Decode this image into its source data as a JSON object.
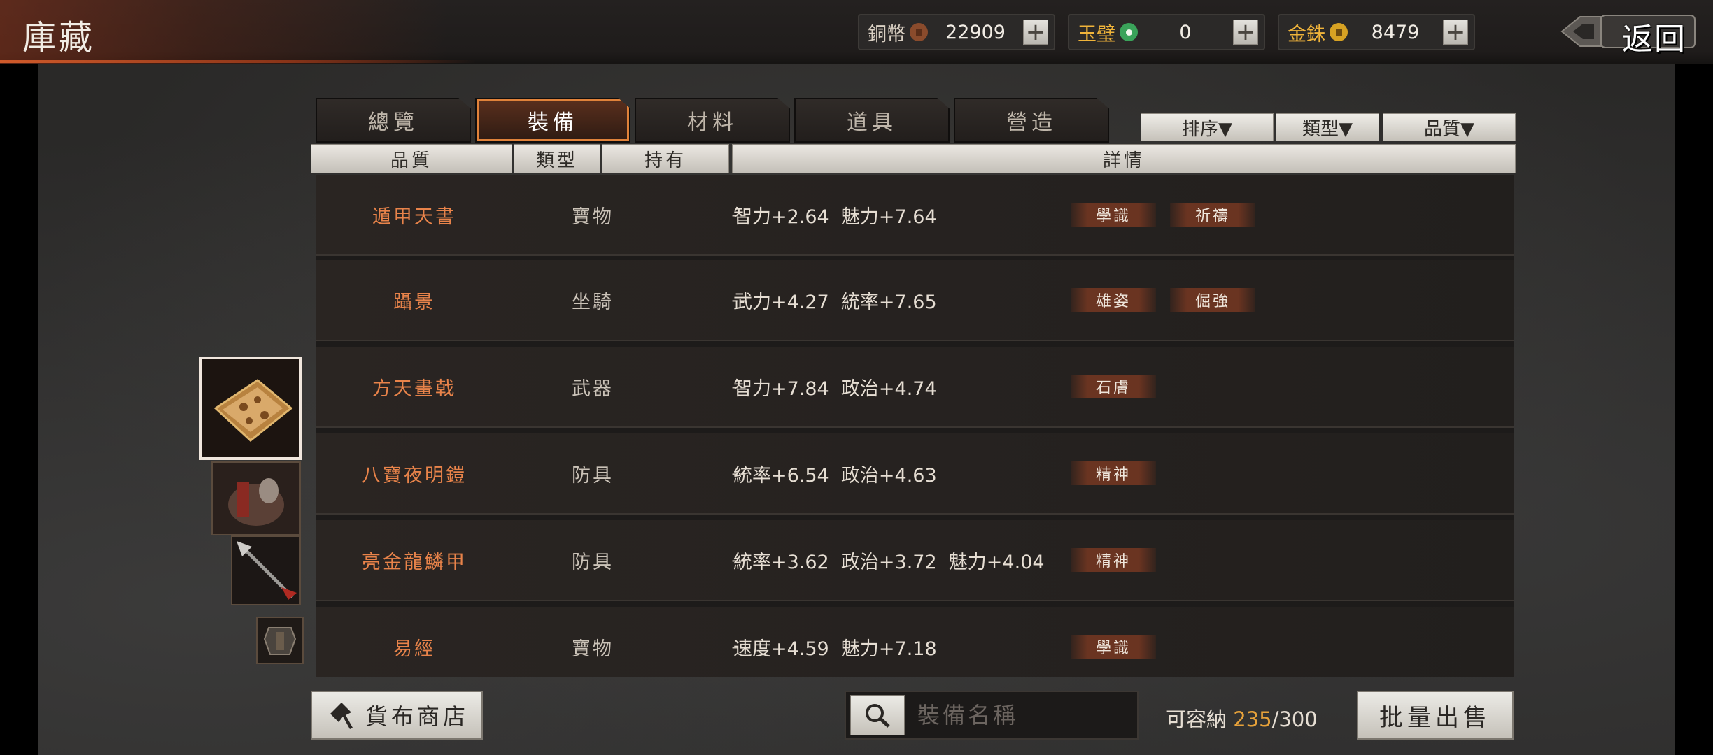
{
  "header": {
    "title": "庫藏",
    "back_label": "返回"
  },
  "currencies": [
    {
      "label": "銅幣",
      "value": "22909",
      "coin_color": "#8a4b2c"
    },
    {
      "label": "玉璧",
      "value": "0",
      "coin_color": "#3aa35a"
    },
    {
      "label": "金銖",
      "value": "8479",
      "coin_color": "#d7a223"
    }
  ],
  "tabs": [
    {
      "label": "總覽",
      "active": false
    },
    {
      "label": "裝備",
      "active": true
    },
    {
      "label": "材料",
      "active": false
    },
    {
      "label": "道具",
      "active": false
    },
    {
      "label": "營造",
      "active": false
    }
  ],
  "filters": {
    "sort": "排序▼",
    "type": "類型▼",
    "quality": "品質▼"
  },
  "columns": {
    "quality": "品質",
    "type": "類型",
    "owned": "持有",
    "details": "詳情"
  },
  "rows": [
    {
      "name": "遁甲天書",
      "type": "寶物",
      "owned": "--",
      "stats": "智力+2.64  魅力+7.64",
      "tags": [
        "學識",
        "祈禱"
      ]
    },
    {
      "name": "躡景",
      "type": "坐騎",
      "owned": "--",
      "stats": "武力+4.27  統率+7.65",
      "tags": [
        "雄姿",
        "倔強"
      ]
    },
    {
      "name": "方天畫戟",
      "type": "武器",
      "owned": "--",
      "stats": "智力+7.84  政治+4.74",
      "tags": [
        "石膚"
      ]
    },
    {
      "name": "八寶夜明鎧",
      "type": "防具",
      "owned": "--",
      "stats": "統率+6.54  政治+4.63",
      "tags": [
        "精神"
      ]
    },
    {
      "name": "亮金龍鱗甲",
      "type": "防具",
      "owned": "--",
      "stats": "統率+3.62  政治+3.72  魅力+4.04",
      "tags": [
        "精神"
      ]
    },
    {
      "name": "易經",
      "type": "寶物",
      "owned": "--",
      "stats": "速度+4.59  魅力+7.18",
      "tags": [
        "學識"
      ]
    }
  ],
  "footer": {
    "shop_label": "貨布商店",
    "search_placeholder": "裝備名稱",
    "capacity_label": "可容納",
    "capacity_used": "235",
    "capacity_total": "/300",
    "bulk_sell_label": "批量出售"
  }
}
